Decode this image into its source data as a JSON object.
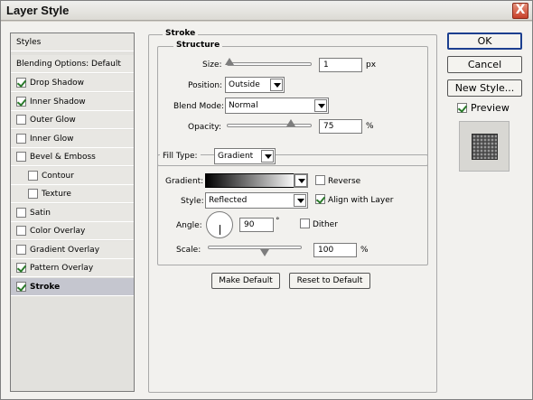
{
  "window": {
    "title": "Layer Style",
    "close_glyph": "X"
  },
  "styles_panel": {
    "header": "Styles",
    "blending": "Blending Options: Default",
    "items": [
      {
        "label": "Drop Shadow",
        "checked": true
      },
      {
        "label": "Inner Shadow",
        "checked": true
      },
      {
        "label": "Outer Glow",
        "checked": false
      },
      {
        "label": "Inner Glow",
        "checked": false
      },
      {
        "label": "Bevel & Emboss",
        "checked": false
      },
      {
        "label": "Contour",
        "checked": false,
        "indent": true
      },
      {
        "label": "Texture",
        "checked": false,
        "indent": true
      },
      {
        "label": "Satin",
        "checked": false
      },
      {
        "label": "Color Overlay",
        "checked": false
      },
      {
        "label": "Gradient Overlay",
        "checked": false
      },
      {
        "label": "Pattern Overlay",
        "checked": true
      },
      {
        "label": "Stroke",
        "checked": true,
        "selected": true
      }
    ]
  },
  "stroke": {
    "title": "Stroke",
    "structure": {
      "title": "Structure",
      "size_label": "Size:",
      "size_value": "1",
      "size_unit": "px",
      "position_label": "Position:",
      "position_value": "Outside",
      "blend_label": "Blend Mode:",
      "blend_value": "Normal",
      "opacity_label": "Opacity:",
      "opacity_value": "75",
      "opacity_unit": "%"
    },
    "fill": {
      "type_label": "Fill Type:",
      "type_value": "Gradient",
      "gradient_label": "Gradient:",
      "gradient_from": "#000000",
      "gradient_to": "#ffffff",
      "reverse_label": "Reverse",
      "reverse_checked": false,
      "style_label": "Style:",
      "style_value": "Reflected",
      "align_label": "Align with Layer",
      "align_checked": true,
      "angle_label": "Angle:",
      "angle_value": "90",
      "angle_unit": "°",
      "dither_label": "Dither",
      "dither_checked": false,
      "scale_label": "Scale:",
      "scale_value": "100",
      "scale_unit": "%"
    },
    "make_default": "Make Default",
    "reset_default": "Reset to Default"
  },
  "buttons": {
    "ok": "OK",
    "cancel": "Cancel",
    "new_style": "New Style...",
    "preview_label": "Preview",
    "preview_checked": true
  },
  "colors": {
    "accent": "#1c3f8f",
    "check": "#2a7a2a",
    "selected_row": "#c5c6cf"
  }
}
